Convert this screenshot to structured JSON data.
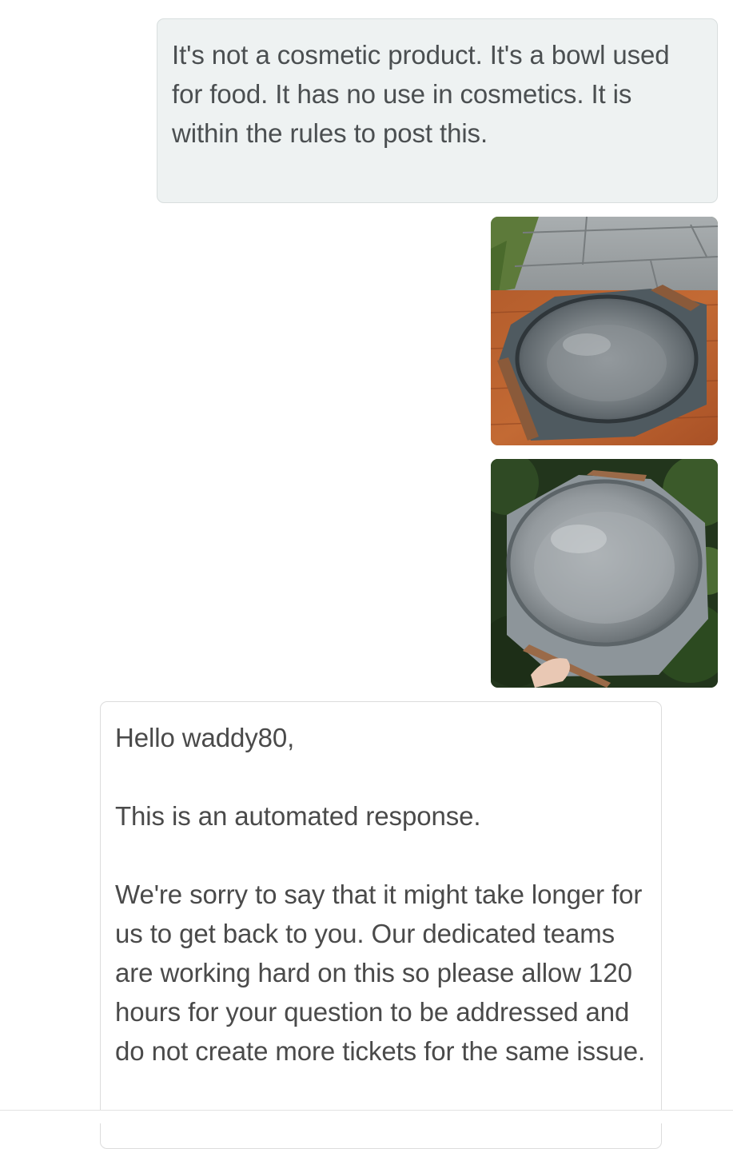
{
  "outgoing_message": {
    "text": "It's not a cosmetic product. It's a bowl used for food. It has no use in cosmetics. It is within the rules to post this."
  },
  "attachments": [
    {
      "icon": "photo-stainless-bowl-on-wooden-table"
    },
    {
      "icon": "photo-stainless-bowl-held-in-hand"
    }
  ],
  "incoming_message": {
    "greeting": "Hello waddy80,",
    "notice": "This is an automated response.",
    "body": "We're sorry to say that it might take longer for us to get back to you. Our dedicated teams are working hard on this so please allow 120 hours for your question to be addressed and do not create more tickets for the same issue."
  },
  "colors": {
    "outgoing_bubble_bg": "#eef2f2",
    "incoming_bubble_bg": "#ffffff",
    "text": "#4a4a4a"
  }
}
